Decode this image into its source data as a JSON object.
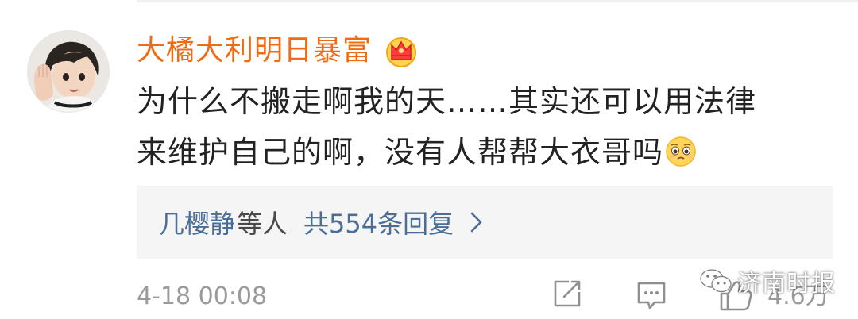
{
  "comment": {
    "username": "大橘大利明日暴富",
    "badge_icon": "crown-badge-icon",
    "text_line1": "为什么不搬走啊我的天……其实还可以用法律",
    "text_line2": "来维护自己的啊，没有人帮帮大衣哥吗",
    "inline_emoji": "pleading-face-emoji"
  },
  "replies": {
    "names": "几樱静",
    "names_suffix": "等人",
    "count_label": "共554条回复",
    "chevron_icon": "chevron-right-icon"
  },
  "footer": {
    "timestamp": "4-18 00:08",
    "like_count": "4.6万",
    "icons": [
      "share-icon",
      "comment-icon",
      "like-icon"
    ]
  },
  "watermark": {
    "text": "济南时报",
    "icon": "wechat-icon"
  },
  "colors": {
    "username": "#f26b14",
    "link": "#4a6e96",
    "muted": "#9a9a9a",
    "body_text": "#222222",
    "reply_bg": "#f5f5f5"
  }
}
